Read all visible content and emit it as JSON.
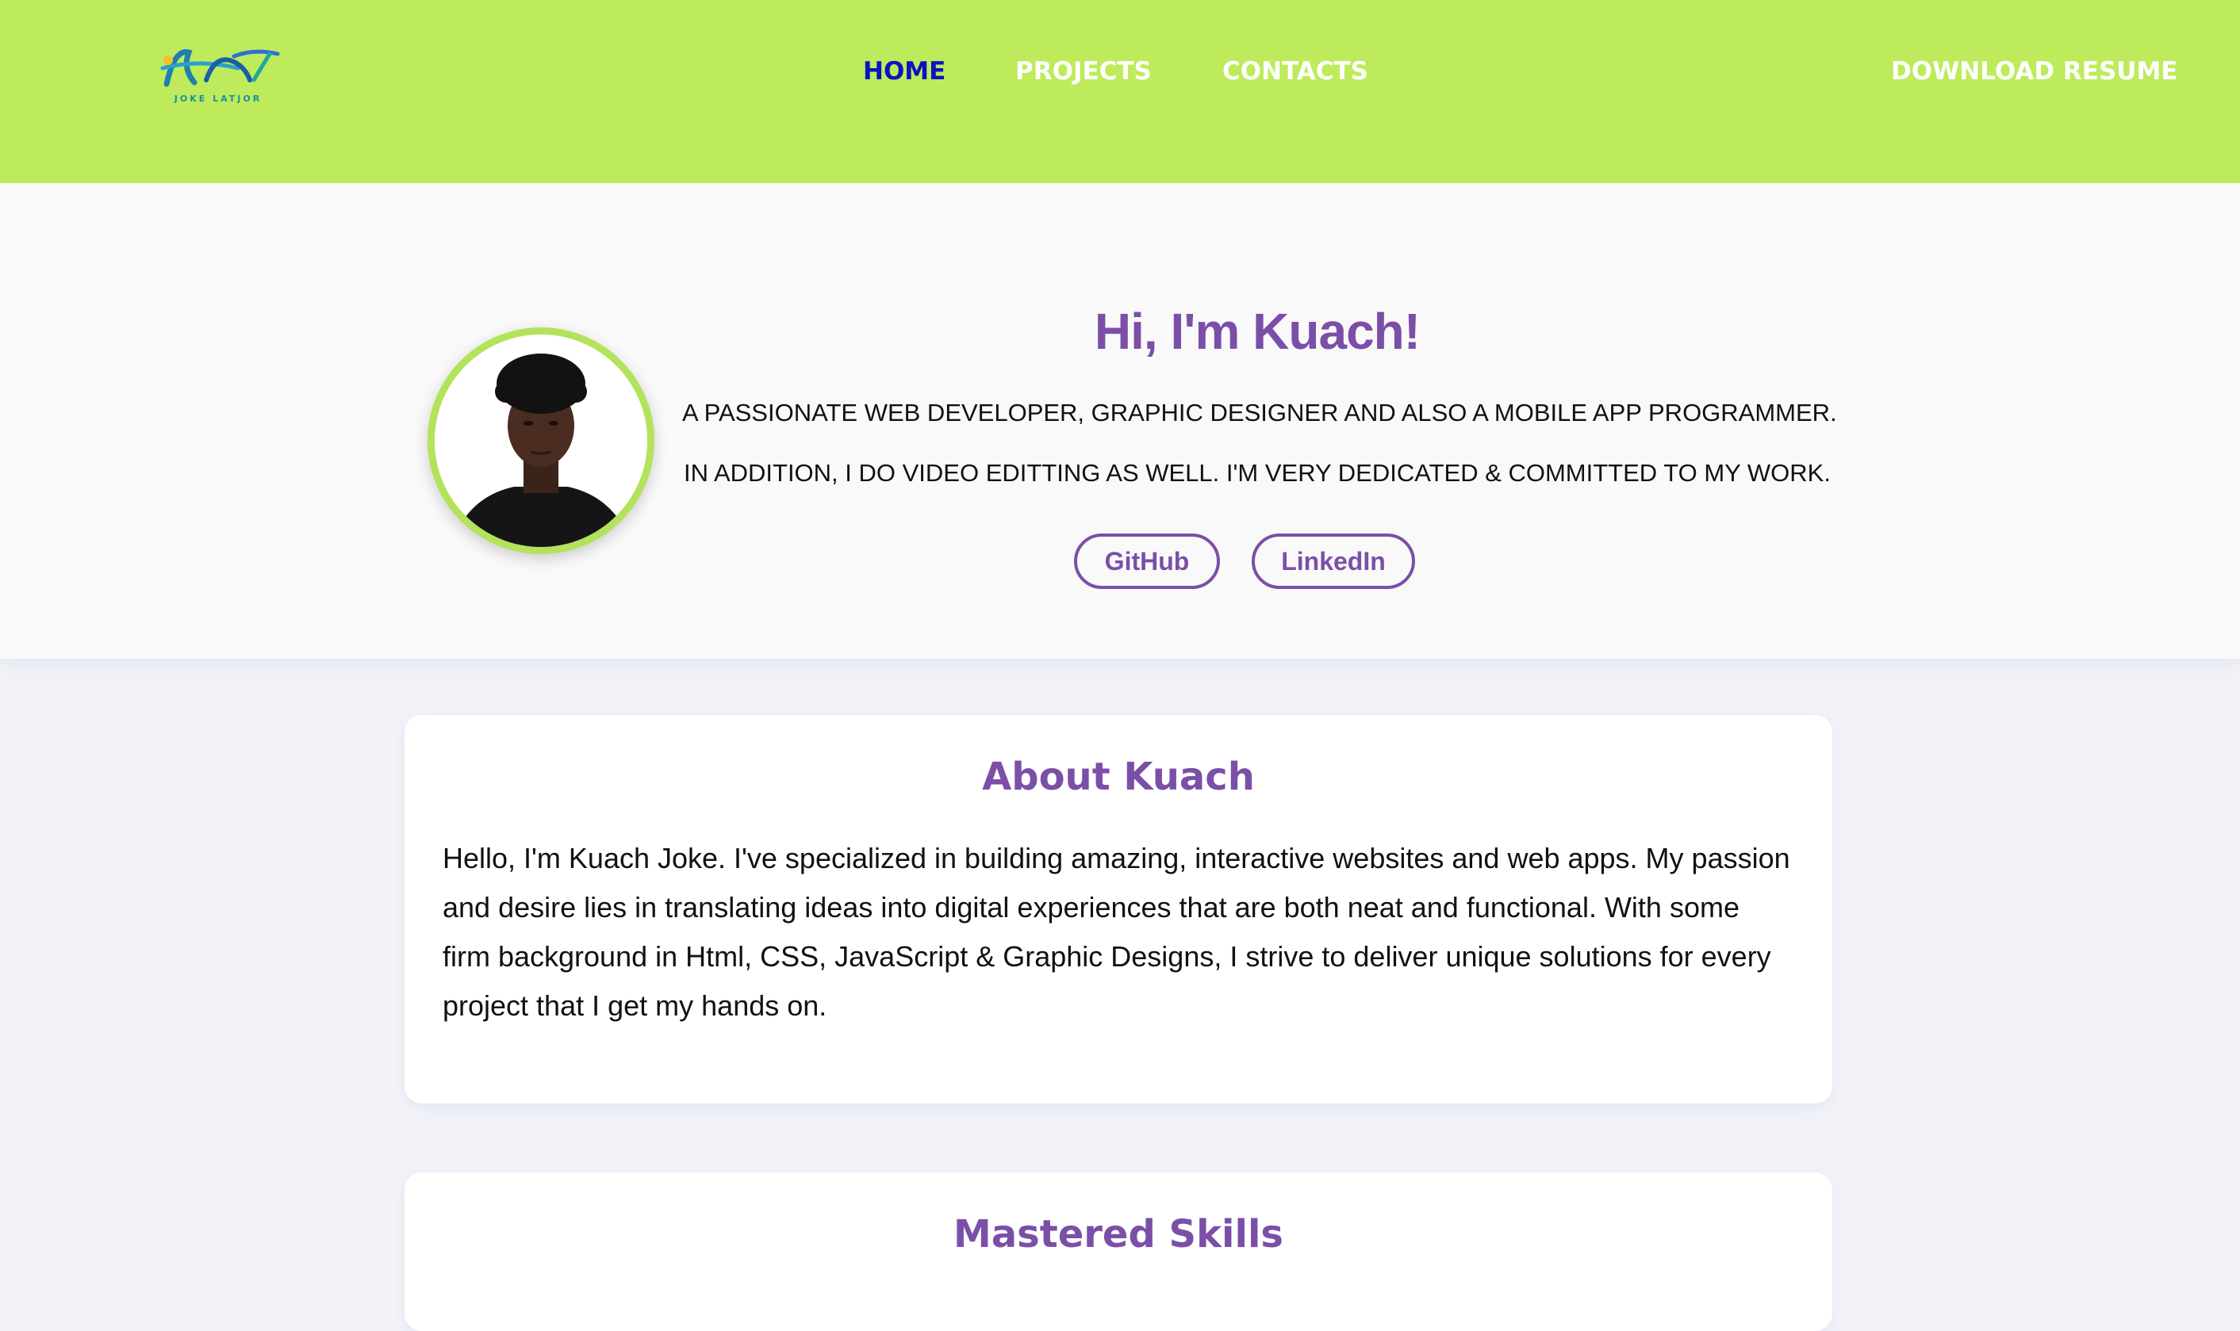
{
  "header": {
    "logo_text": "JOKE LATJOR",
    "nav": {
      "home": "HOME",
      "projects": "PROJECTS",
      "contacts": "CONTACTS"
    },
    "download_resume": "DOWNLOAD RESUME"
  },
  "hero": {
    "title": "Hi, I'm Kuach!",
    "line1": "A PASSIONATE WEB DEVELOPER, GRAPHIC DESIGNER AND ALSO A MOBILE APP PROGRAMMER.",
    "line2": "IN ADDITION, I DO VIDEO EDITTING AS WELL. I'M VERY DEDICATED & COMMITTED TO MY WORK.",
    "buttons": {
      "github": "GitHub",
      "linkedin": "LinkedIn"
    }
  },
  "about": {
    "title": "About Kuach",
    "text": "Hello, I'm Kuach Joke. I've specialized in building amazing, interactive websites and web apps. My passion and desire lies in translating ideas into digital experiences that are both neat and functional. With some firm background in Html, CSS, JavaScript & Graphic Designs, I strive to deliver unique solutions for every project that I get my hands on."
  },
  "skills": {
    "title": "Mastered Skills"
  },
  "colors": {
    "header_bg": "#bdeb5b",
    "accent_purple": "#7b4fa8",
    "nav_active": "#0a13c2"
  }
}
